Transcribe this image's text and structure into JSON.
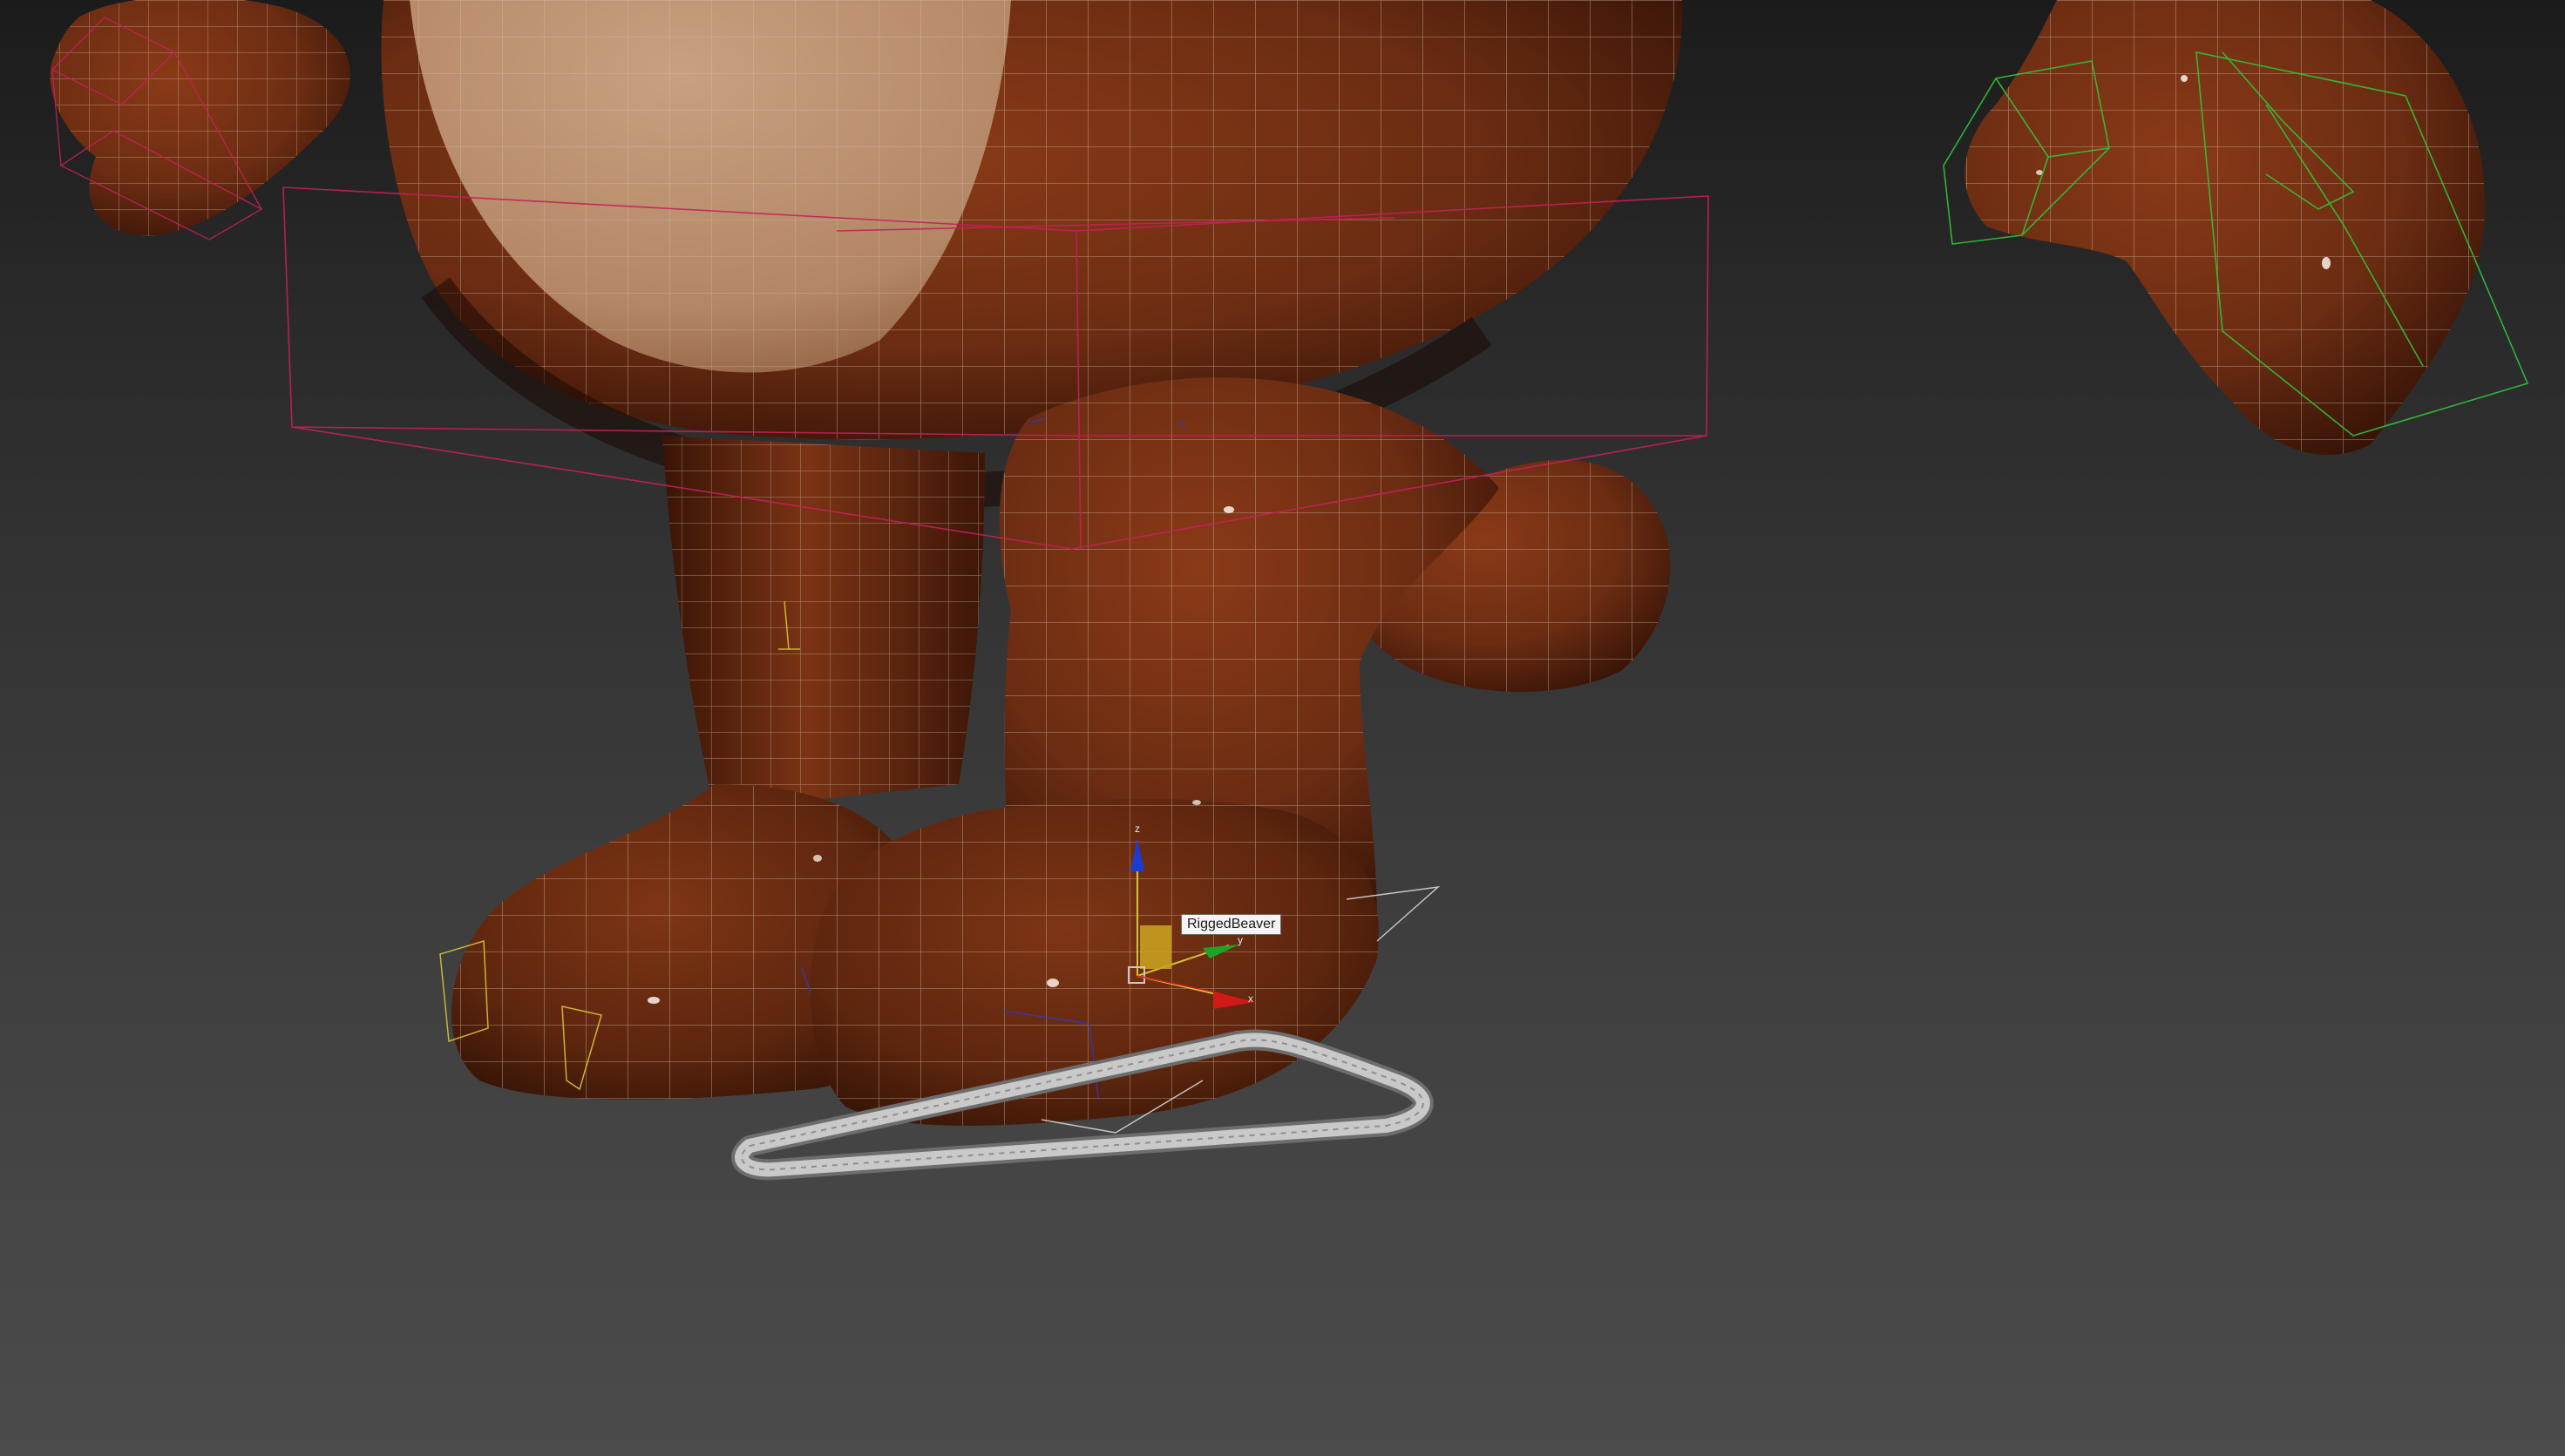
{
  "viewport": {
    "selected_object": {
      "label": "RiggedBeaver"
    },
    "gizmo": {
      "axes": [
        {
          "name": "x",
          "color": "#d01a1a"
        },
        {
          "name": "y",
          "color": "#1ea32a"
        },
        {
          "name": "z",
          "color": "#1a3cd0"
        }
      ]
    },
    "colors": {
      "background_top": "#1b1b1b",
      "background_bottom": "#4b4b4b",
      "fur": "#6b2c12",
      "fur_dark": "#3a1407",
      "belly": "#c9a080",
      "wireframe": "#d9c4b2",
      "bone_pink": "#c4205a",
      "bone_green": "#2fc43a",
      "bone_yellow": "#d6c33c",
      "control_shape": "#c9c9c9"
    }
  }
}
